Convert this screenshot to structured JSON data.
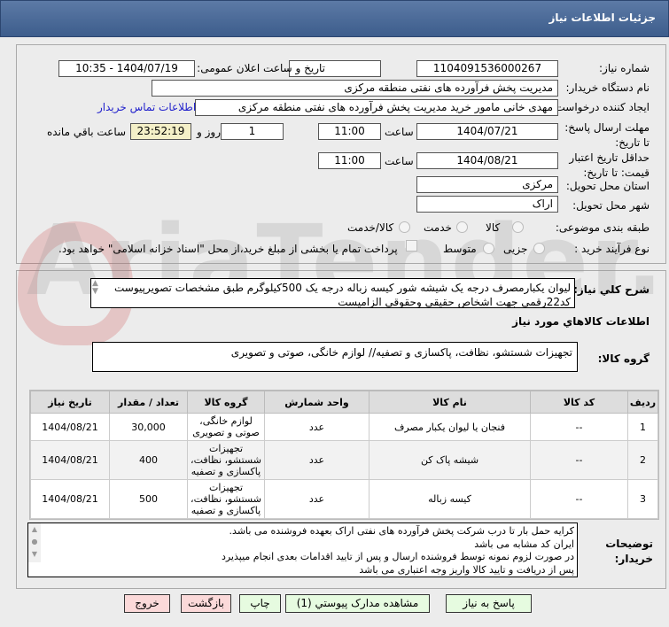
{
  "header": {
    "title": "جزئیات اطلاعات نیاز"
  },
  "fields": {
    "need_number_label": "شماره نیاز:",
    "need_number": "1104091536000267",
    "announce_label": "تاریخ و ساعت اعلان عمومی:",
    "announce_value": "1404/07/19 - 10:35",
    "buyer_org_label": "نام دستگاه خریدار:",
    "buyer_org": "مدیریت پخش فرآورده های نفتی منطقه مرکزی",
    "creator_label": "ایجاد کننده درخواست:",
    "creator": "مهدی خانی مامور خرید مدیریت پخش فرآورده های نفتی منطقه مرکزی",
    "contact_link": "اطلاعات تماس خریدار",
    "deadline_label": "مهلت ارسال پاسخ: تا تاریخ:",
    "deadline_date": "1404/07/21",
    "time_label": "ساعت",
    "deadline_time": "11:00",
    "days": "1",
    "days_label": "روز و",
    "remaining": "23:52:19",
    "remaining_label": "ساعت باقي مانده",
    "validity_label": "حداقل تاریخ اعتبار قیمت: تا تاریخ:",
    "validity_date": "1404/08/21",
    "validity_time": "11:00",
    "province_label": "استان محل تحویل:",
    "province": "مرکزی",
    "city_label": "شهر محل تحویل:",
    "city": "اراک",
    "category_label": "طبقه بندی موضوعی:",
    "cat_goods": "کالا",
    "cat_service": "خدمت",
    "cat_both": "کالا/خدمت",
    "process_label": "نوع فرآیند خرید :",
    "proc_small": "جزیی",
    "proc_medium": "متوسط",
    "payment_note": "پرداخت تمام یا بخشی از مبلغ خرید،از محل \"اسناد خزانه اسلامی\" خواهد بود."
  },
  "description": {
    "label": "شرح کلي نياز:",
    "text": "ليوان يکبارمصرف درجه يک شيشه شور کيسه زباله درجه يک 500کيلوگرم طبق مشخصات تصويرپيوست کد22رقمي  جهت اشخاص حقيقي وحقوقي الزاميست"
  },
  "goods_info_title": "اطلاعات کالاهاي مورد نياز",
  "goods_group": {
    "label": "گروه کالا:",
    "text": "تجهیزات شستشو، نظافت، پاکسازی و تصفیه// لوازم خانگی، صوتی و تصویری"
  },
  "table": {
    "headers": [
      "ردیف",
      "کد کالا",
      "نام کالا",
      "واحد شمارش",
      "گروه کالا",
      "تعداد / مقدار",
      "تاریخ نیاز"
    ],
    "rows": [
      [
        "1",
        "--",
        "فنجان یا لیوان یکبار مصرف",
        "عدد",
        "لوازم خانگی، صوتی و تصویری",
        "30,000",
        "1404/08/21"
      ],
      [
        "2",
        "--",
        "شیشه پاک کن",
        "عدد",
        "تجهیزات شستشو، نظافت، پاکسازی و تصفیه",
        "400",
        "1404/08/21"
      ],
      [
        "3",
        "--",
        "کیسه زباله",
        "عدد",
        "تجهیزات شستشو، نظافت، پاکسازی و تصفیه",
        "500",
        "1404/08/21"
      ]
    ]
  },
  "notes": {
    "label": "توضیحات خریدار:",
    "lines": [
      "کرایه حمل بار تا درب شرکت  پخش فرآورده های نفتی اراک بعهده فروشنده می باشد.",
      "ایران کد مشابه می باشد",
      "در صورت لزوم نمونه توسط فروشنده ارسال و پس از تایید اقدامات بعدی انجام میپذیرد",
      "پس از دریافت و تایید کالا واریز وجه اعتباری می باشد"
    ]
  },
  "buttons": {
    "reply": "پاسخ به نیاز",
    "attachments": "مشاهده مدارک پیوستي (1)",
    "print": "چاپ",
    "back": "بازگشت",
    "exit": "خروج"
  },
  "watermark": "AriaTender.net"
}
